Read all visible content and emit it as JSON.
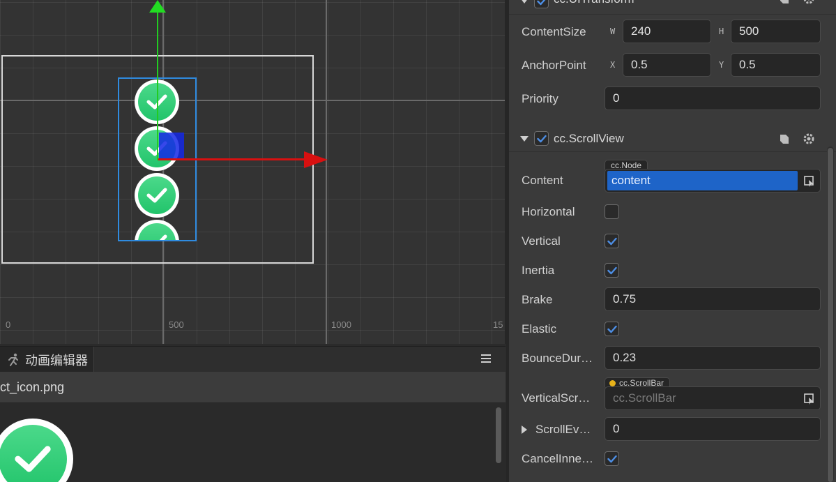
{
  "scene": {
    "axis_labels": [
      "0",
      "500",
      "1000",
      "15"
    ]
  },
  "anim": {
    "tab_title": "动画编辑器",
    "clip_name": "ct_icon.png"
  },
  "inspector": {
    "uitransform": {
      "title": "cc.UITransform",
      "content_size_label": "ContentSize",
      "w_label": "W",
      "w_value": "240",
      "h_label": "H",
      "h_value": "500",
      "anchor_label": "AnchorPoint",
      "x_label": "X",
      "x_value": "0.5",
      "y_label": "Y",
      "y_value": "0.5",
      "priority_label": "Priority",
      "priority_value": "0"
    },
    "scrollview": {
      "title": "cc.ScrollView",
      "content_label": "Content",
      "content_tag": "cc.Node",
      "content_value": "content",
      "horizontal_label": "Horizontal",
      "horizontal_checked": false,
      "vertical_label": "Vertical",
      "vertical_checked": true,
      "inertia_label": "Inertia",
      "inertia_checked": true,
      "brake_label": "Brake",
      "brake_value": "0.75",
      "elastic_label": "Elastic",
      "elastic_checked": true,
      "bounce_label": "BounceDur…",
      "bounce_value": "0.23",
      "vscroll_label": "VerticalScr…",
      "vscroll_tag": "cc.ScrollBar",
      "vscroll_placeholder": "cc.ScrollBar",
      "scrollev_label": "ScrollEv…",
      "scrollev_value": "0",
      "cancel_label": "CancelInne…",
      "cancel_checked": true
    }
  },
  "colors": {
    "accent": "#1e64c8",
    "gizmo_x": "#d81010",
    "gizmo_y": "#22cc22",
    "selection": "#2f8be0",
    "check_green": "#22c46b"
  }
}
